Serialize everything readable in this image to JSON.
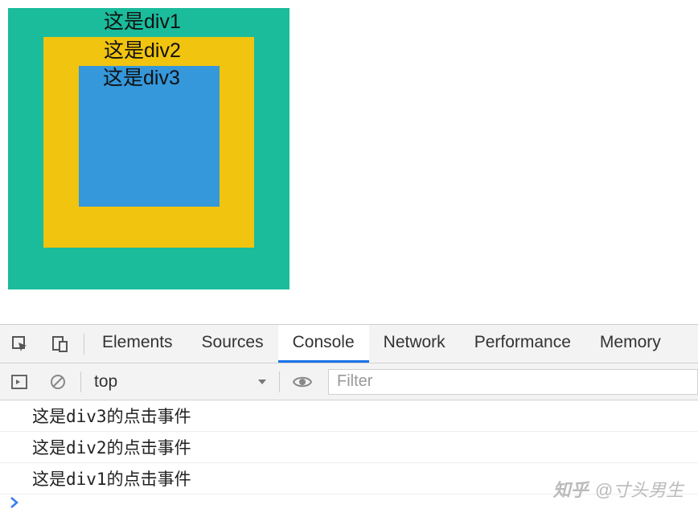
{
  "divs": {
    "div1_label": "这是div1",
    "div2_label": "这是div2",
    "div3_label": "这是div3"
  },
  "devtools": {
    "tabs": {
      "elements": "Elements",
      "sources": "Sources",
      "console": "Console",
      "network": "Network",
      "performance": "Performance",
      "memory": "Memory"
    },
    "context": "top",
    "filter_placeholder": "Filter",
    "logs": [
      "这是div3的点击事件",
      "这是div2的点击事件",
      "这是div1的点击事件"
    ],
    "prompt_symbol": "›"
  },
  "watermark": {
    "brand": "知乎",
    "handle": "@寸头男生"
  }
}
